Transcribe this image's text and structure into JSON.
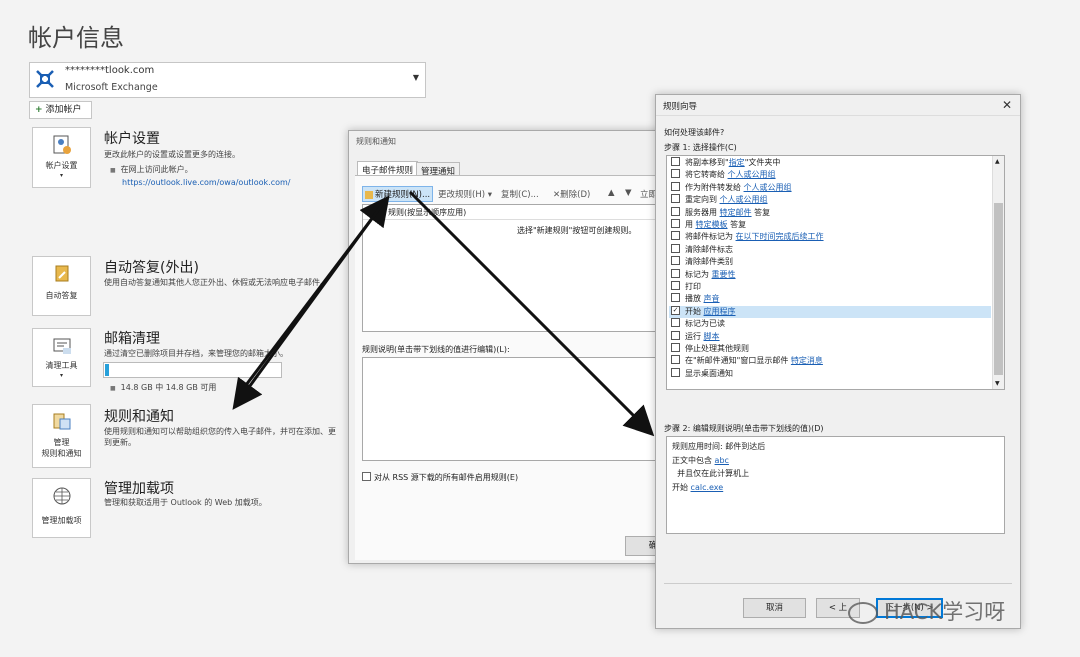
{
  "page": {
    "title": "帐户信息"
  },
  "account": {
    "email": "********tlook.com",
    "type": "Microsoft Exchange",
    "add_label": "添加帐户"
  },
  "sections": [
    {
      "tile_label": "帐户设置",
      "title": "帐户设置",
      "desc": "更改此帐户的设置或设置更多的连接。",
      "sub": "在网上访问此帐户。",
      "link": "https://outlook.live.com/owa/outlook.com/"
    },
    {
      "tile_label": "自动答复",
      "title": "自动答复(外出)",
      "desc": "使用自动答复通知其他人您正外出、休假或无法响应电子邮件。"
    },
    {
      "tile_label": "清理工具",
      "title": "邮箱清理",
      "desc": "通过清空已删除项目并存档，来管理您的邮箱大小。",
      "usage": "14.8 GB 中 14.8 GB 可用",
      "usage_fraction": 0.02
    },
    {
      "tile_label": "管理\n规则和通知",
      "title": "规则和通知",
      "desc": "使用规则和通知可以帮助组织您的传入电子邮件，并可在添加、更",
      "desc2": "到更新。"
    },
    {
      "tile_label": "管理加载项",
      "title": "管理加载项",
      "desc": "管理和获取适用于 Outlook 的 Web 加载项。"
    }
  ],
  "rules_dialog": {
    "title": "规则和通知",
    "tab_email": "电子邮件规则",
    "tab_manage": "管理通知",
    "btn_new": "新建规则(N)...",
    "btn_change": "更改规则(H)",
    "btn_copy": "复制(C)...",
    "btn_delete": "删除(D)",
    "btn_run": "立即",
    "list_header": "规则(按显示顺序应用)",
    "list_hint": "选择\"新建规则\"按钮可创建规则。",
    "desc_label": "规则说明(单击带下划线的值进行编辑)(L):",
    "rss_label": "对从 RSS 源下载的所有邮件启用规则(E)",
    "btn_ok": "确"
  },
  "wizard": {
    "title": "规则向导",
    "question": "如何处理该邮件?",
    "step1": "步骤 1: 选择操作(C)",
    "actions": [
      {
        "pre": "将副本移到\"",
        "link": "指定",
        "post": "\"文件夹中",
        "checked": false
      },
      {
        "pre": "将它转寄给 ",
        "link": "个人或公用组",
        "post": "",
        "checked": false
      },
      {
        "pre": "作为附件转发给 ",
        "link": "个人或公用组",
        "post": "",
        "checked": false
      },
      {
        "pre": "重定向到 ",
        "link": "个人或公用组",
        "post": "",
        "checked": false
      },
      {
        "pre": "服务器用 ",
        "link": "特定邮件",
        "post": " 答复",
        "checked": false
      },
      {
        "pre": "用 ",
        "link": "特定模板",
        "post": " 答复",
        "checked": false
      },
      {
        "pre": "将邮件标记为 ",
        "link": "在以下时间完成后续工作",
        "post": "",
        "checked": false
      },
      {
        "pre": "清除邮件标志",
        "link": "",
        "post": "",
        "checked": false
      },
      {
        "pre": "清除邮件类别",
        "link": "",
        "post": "",
        "checked": false
      },
      {
        "pre": "标记为 ",
        "link": "重要性",
        "post": "",
        "checked": false
      },
      {
        "pre": "打印",
        "link": "",
        "post": "",
        "checked": false
      },
      {
        "pre": "播放 ",
        "link": "声音",
        "post": "",
        "checked": false
      },
      {
        "pre": "开始 ",
        "link": "应用程序",
        "post": "",
        "checked": true
      },
      {
        "pre": "标记为已读",
        "link": "",
        "post": "",
        "checked": false
      },
      {
        "pre": "运行 ",
        "link": "脚本",
        "post": "",
        "checked": false
      },
      {
        "pre": "停止处理其他规则",
        "link": "",
        "post": "",
        "checked": false
      },
      {
        "pre": "在\"新邮件通知\"窗口显示邮件 ",
        "link": "特定消息",
        "post": "",
        "checked": false
      },
      {
        "pre": "显示桌面通知",
        "link": "",
        "post": "",
        "checked": false
      }
    ],
    "step2": "步骤 2: 编辑规则说明(单击带下划线的值)(D)",
    "desc_lines": [
      {
        "pre": "规则应用时间: 邮件到达后",
        "link": ""
      },
      {
        "pre": "正文中包含 ",
        "link": "abc"
      },
      {
        "pre": "  并且仅在此计算机上",
        "link": ""
      },
      {
        "pre": "开始 ",
        "link": "calc.exe"
      }
    ],
    "btn_cancel": "取消",
    "btn_back": "< 上",
    "btn_next": "下一步(N) >"
  },
  "watermark": "HACK学习呀"
}
